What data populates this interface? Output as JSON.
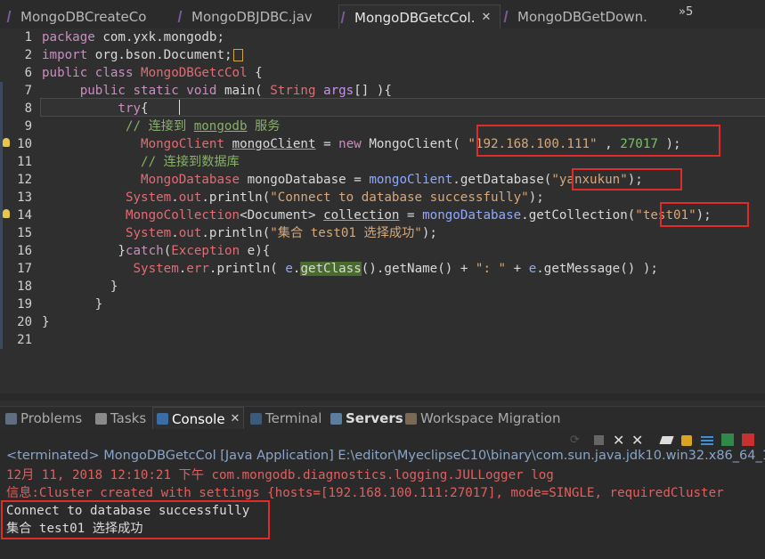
{
  "tabs": [
    {
      "label": "MongoDBCreateCo",
      "active": false
    },
    {
      "label": "MongoDBJDBC.jav",
      "active": false
    },
    {
      "label": "MongoDBGetcCol.",
      "active": true
    },
    {
      "label": "MongoDBGetDown.",
      "active": false
    }
  ],
  "tabs_more": "»5",
  "line_numbers": [
    "1",
    "2",
    "6",
    "7",
    "8",
    "9",
    "10",
    "11",
    "12",
    "13",
    "14",
    "15",
    "16",
    "17",
    "18",
    "19",
    "20",
    "21"
  ],
  "code": {
    "l1_kw": "package",
    "l1_rest": " com.yxk.mongodb;",
    "l2_kw": "import",
    "l2_rest": " org.bson.Document;",
    "l3_kw": "public class",
    "l3_name": "MongoDBGetcCol",
    "l3_rest": " {",
    "l4_kw": "public static void",
    "l4_main": " main(",
    "l4_type": "String",
    "l4_args": "args",
    "l4_rest": "[] ){",
    "l5_kw": "try",
    "l5_rest": "{",
    "l6_comment_a": "// 连接到 ",
    "l6_comment_b": "mongodb",
    "l6_comment_c": " 服务",
    "l7_type": "MongoClient",
    "l7_var": "mongoClient",
    "l7_eq": " = ",
    "l7_new": "new",
    "l7_ctor": " MongoClient(",
    "l7_host": "\"192.168.100.111\"",
    "l7_comma": " , ",
    "l7_port": "27017",
    "l7_end": " );",
    "l8_comment": "// 连接到数据库",
    "l9_type": "MongoDatabase",
    "l9_var": "mongoDatabase",
    "l9_eq": " = ",
    "l9_obj": "mongoClient",
    "l9_call": ".getDatabase(",
    "l9_arg": "\"yanxukun\"",
    "l9_end": ");",
    "l10_sys": "System",
    "l10_dot": ".",
    "l10_out": "out",
    "l10_call": ".println(",
    "l10_str": "\"Connect to database successfully\"",
    "l10_end": ");",
    "l11_type": "MongoCollection",
    "l11_gen": "<Document> ",
    "l11_var": "collection",
    "l11_eq": " = ",
    "l11_obj": "mongoDatabase",
    "l11_call": ".getCollection(",
    "l11_arg": "\"test01\"",
    "l11_end": ");",
    "l12_sys": "System",
    "l12_dot": ".",
    "l12_out": "out",
    "l12_call": ".println(",
    "l12_str": "\"集合 test01 选择成功\"",
    "l12_end": ");",
    "l13_a": "}",
    "l13_kw": "catch",
    "l13_b": "(",
    "l13_type": "Exception",
    "l13_c": " e){",
    "l14_sys": "System",
    "l14_dot": ".",
    "l14_err": "err",
    "l14_call": ".println( ",
    "l14_e1": "e",
    "l14_dot2": ".",
    "l14_getclass": "getClass",
    "l14_mid": "().getName() + ",
    "l14_str": "\": \"",
    "l14_plus": " + ",
    "l14_e2": "e",
    "l14_end": ".getMessage() );",
    "l15": "}",
    "l16": "}",
    "l17": "}"
  },
  "views": [
    {
      "label": "Problems",
      "icon": "problems-icon",
      "active": false
    },
    {
      "label": "Tasks",
      "icon": "tasks-icon",
      "active": false
    },
    {
      "label": "Console",
      "icon": "console-icon",
      "active": true
    },
    {
      "label": "Terminal",
      "icon": "terminal-icon",
      "active": false
    },
    {
      "label": "Servers",
      "icon": "servers-icon",
      "active": false
    },
    {
      "label": "Workspace Migration",
      "icon": "workspace-migration-icon",
      "active": false
    }
  ],
  "console": {
    "terminated": "<terminated> MongoDBGetcCol [Java Application] E:\\editor\\MyeclipseC10\\binary\\com.sun.java.jdk10.win32.x86_64_1",
    "log1": "12月 11, 2018 12:10:21 下午 com.mongodb.diagnostics.logging.JULLogger log",
    "log2": "信息:Cluster created with settings {hosts=[192.168.100.111:27017], mode=SINGLE, requiredCluster",
    "out1": "Connect to database successfully",
    "out2": "集合 test01 选择成功"
  },
  "colors": {
    "background": "#2f2f2f",
    "highlight_box": "#e02b2b",
    "keyword": "#c98ec0",
    "string": "#d6a87b",
    "comment": "#89b069"
  }
}
